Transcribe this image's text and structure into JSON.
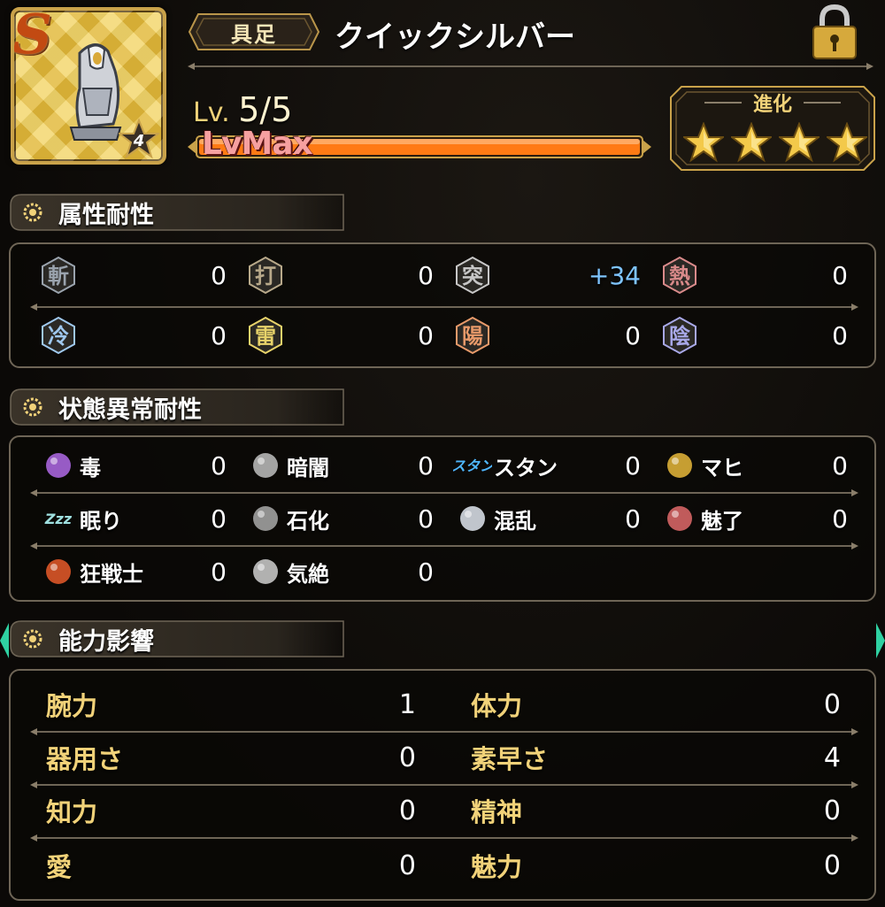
{
  "colors": {
    "gold": "#f1d279",
    "accent_plus": "#7ec4ff",
    "card": "#eac64a",
    "bar": "#ff7a14"
  },
  "item": {
    "rarity_glyph": "S",
    "rank": "4",
    "category": "具足",
    "name": "クイックシルバー",
    "lock_icon": "padlock-icon",
    "level_prefix": "Lv.",
    "level": "5/5",
    "level_progress": 1.0,
    "lvmax_label": "LvMax",
    "evolution_label": "進化",
    "evolution_stars": 4
  },
  "element_section": {
    "title": "属性耐性",
    "items": [
      {
        "glyph": "斬",
        "icon": "slash-icon",
        "value": "0",
        "plus": false
      },
      {
        "glyph": "打",
        "icon": "blunt-icon",
        "value": "0",
        "plus": false
      },
      {
        "glyph": "突",
        "icon": "pierce-icon",
        "value": "+34",
        "plus": true
      },
      {
        "glyph": "熱",
        "icon": "heat-icon",
        "value": "0",
        "plus": false
      },
      {
        "glyph": "冷",
        "icon": "cold-icon",
        "value": "0",
        "plus": false
      },
      {
        "glyph": "雷",
        "icon": "thunder-icon",
        "value": "0",
        "plus": false
      },
      {
        "glyph": "陽",
        "icon": "light-icon",
        "value": "0",
        "plus": false
      },
      {
        "glyph": "陰",
        "icon": "dark-icon",
        "value": "0",
        "plus": false
      }
    ]
  },
  "status_section": {
    "title": "状態異常耐性",
    "items": [
      {
        "label": "毒",
        "icon": "poison-icon",
        "value": "0"
      },
      {
        "label": "暗闇",
        "icon": "blind-icon",
        "value": "0"
      },
      {
        "label": "スタン",
        "icon": "stun-icon",
        "icon_text": "スタン",
        "value": "0"
      },
      {
        "label": "マヒ",
        "icon": "paralysis-icon",
        "value": "0"
      },
      {
        "label": "眠り",
        "icon": "sleep-icon",
        "icon_text": "Zzz",
        "value": "0"
      },
      {
        "label": "石化",
        "icon": "petrify-icon",
        "value": "0"
      },
      {
        "label": "混乱",
        "icon": "confusion-icon",
        "value": "0"
      },
      {
        "label": "魅了",
        "icon": "charm-icon",
        "value": "0"
      },
      {
        "label": "狂戦士",
        "icon": "berserk-icon",
        "value": "0"
      },
      {
        "label": "気絶",
        "icon": "faint-icon",
        "value": "0"
      }
    ]
  },
  "ability_section": {
    "title": "能力影響",
    "items": [
      {
        "label": "腕力",
        "value": "1"
      },
      {
        "label": "体力",
        "value": "0"
      },
      {
        "label": "器用さ",
        "value": "0"
      },
      {
        "label": "素早さ",
        "value": "4"
      },
      {
        "label": "知力",
        "value": "0"
      },
      {
        "label": "精神",
        "value": "0"
      },
      {
        "label": "愛",
        "value": "0"
      },
      {
        "label": "魅力",
        "value": "0"
      }
    ]
  }
}
